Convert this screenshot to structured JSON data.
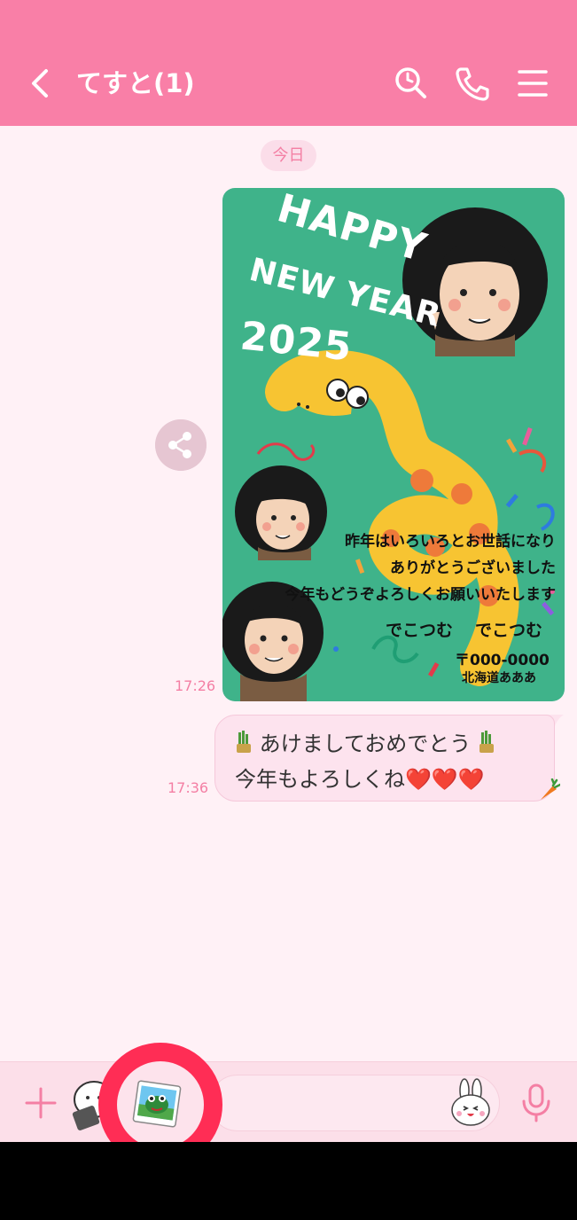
{
  "header": {
    "title": "てすと(1)",
    "icons": [
      "back-chevron-icon",
      "search-icon",
      "phone-icon",
      "menu-icon"
    ],
    "bg": "#f97fa7"
  },
  "chat": {
    "date_label": "今日",
    "messages": [
      {
        "type": "image",
        "time": "17:26",
        "card": {
          "hny_1": "HAPPY",
          "hny_2": "NEW YEAR",
          "year": "2025",
          "greeting_1": "昨年はいろいろとお世話になり",
          "greeting_2": "ありがとうございました",
          "greeting_3": "今年もどうぞよろしくお願いいたします",
          "sender_1": "でこつむ",
          "sender_2": "でこつむ",
          "postal": "〒000-0000",
          "address": "北海道あああ"
        }
      },
      {
        "type": "text",
        "time": "17:36",
        "line1": "あけましておめでとう",
        "line2": "今年もよろしくね❤️❤️❤️",
        "reaction_icon": "carrot-icon"
      }
    ]
  },
  "input": {
    "icons": [
      "plus-icon",
      "sticker-icon",
      "album-icon",
      "emoji-icon",
      "mic-icon"
    ]
  },
  "colors": {
    "accent": "#f97fa7",
    "highlight_ring": "#ff2d55",
    "card_bg": "#3fb38a"
  }
}
